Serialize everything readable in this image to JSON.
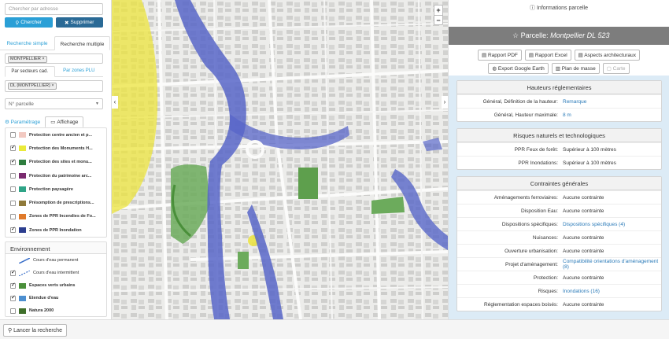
{
  "left": {
    "search_placeholder": "Chercher par adresse",
    "btn_search": "Chercher",
    "btn_delete": "Supprimer",
    "tab_simple": "Recherche simple",
    "tab_multiple": "Recherche multiple",
    "tag_city": "MONTPELLIER",
    "tab_sections": "Par secteurs cad.",
    "tab_zones": "Par zones PLU",
    "tag_section": "DL (MONTPELLIER)",
    "select_parcel": "N° parcelle",
    "param_label": "Paramétrage",
    "affichage_label": "Affichage",
    "layers": [
      {
        "label": "Protection centre ancien et p...",
        "color": "#f2c9c1",
        "checked": false
      },
      {
        "label": "Protection des Monuments H...",
        "color": "#eaea3a",
        "checked": true
      },
      {
        "label": "Protection des sites et monu...",
        "color": "#2e7d3e",
        "checked": true
      },
      {
        "label": "Protection du patrimoine arc...",
        "color": "#7a2a6e",
        "checked": false
      },
      {
        "label": "Protection paysagère",
        "color": "#2fa487",
        "checked": false
      },
      {
        "label": "Présomption de prescriptions...",
        "color": "#8f7a3a",
        "checked": false
      },
      {
        "label": "Zones de PPR Incendies de Fo...",
        "color": "#e07a2a",
        "checked": false
      },
      {
        "label": "Zones de PPR Inondation",
        "color": "#2c3e8f",
        "checked": true
      }
    ],
    "env_title": "Environnement",
    "env_items": [
      {
        "label": "Cours d'eau permanent",
        "kind": "line-solid",
        "checked": false
      },
      {
        "label": "Cours d'eau intermittent",
        "kind": "line-dash",
        "checked": true
      },
      {
        "label": "Espaces verts urbains",
        "color": "#4a8f3a",
        "checked": true
      },
      {
        "label": "Etendue d'eau",
        "color": "#4d8fd0",
        "checked": true
      },
      {
        "label": "Natura 2000",
        "color": "#3f6f2a",
        "checked": false
      }
    ]
  },
  "map": {
    "zoom_in": "+",
    "zoom_out": "−",
    "collapse_left": "‹",
    "collapse_right": "›"
  },
  "right": {
    "info_header": "Informations parcelle",
    "parcel_prefix": "Parcelle:",
    "parcel_name": "Montpellier DL 523",
    "actions": [
      "Rapport PDF",
      "Rapport Excel",
      "Aspects architecturaux",
      "Export Google Earth",
      "Plan de masse",
      "Carte"
    ],
    "sections": [
      {
        "title": "Hauteurs réglementaires",
        "rows": [
          {
            "k": "Général, Définition de la hauteur:",
            "v": "Remarque",
            "link": true
          },
          {
            "k": "Général, Hauteur maximale:",
            "v": "8 m",
            "link": true
          }
        ]
      },
      {
        "title": "Risques naturels et technologiques",
        "rows": [
          {
            "k": "PPR Feux de forêt:",
            "v": "Supérieur à 100 mètres",
            "link": false
          },
          {
            "k": "PPR Inondations:",
            "v": "Supérieur à 100 mètres",
            "link": false
          }
        ]
      },
      {
        "title": "Contraintes générales",
        "rows": [
          {
            "k": "Aménagements ferroviaires:",
            "v": "Aucune contrainte",
            "link": false
          },
          {
            "k": "Disposition Eau:",
            "v": "Aucune contrainte",
            "link": false
          },
          {
            "k": "Dispositions spécifiques:",
            "v": "Dispositions spécifiques (4)",
            "link": true
          },
          {
            "k": "Nuisances:",
            "v": "Aucune contrainte",
            "link": false
          },
          {
            "k": "Ouverture urbanisation:",
            "v": "Aucune contrainte",
            "link": false
          },
          {
            "k": "Projet d'aménagement:",
            "v": "Compatibilité orientations d'aménagement (8)",
            "link": true
          },
          {
            "k": "Protection:",
            "v": "Aucune contrainte",
            "link": false
          },
          {
            "k": "Risques:",
            "v": "Inondations (16)",
            "link": true
          },
          {
            "k": "Réglementation espaces boisés:",
            "v": "Aucune contrainte",
            "link": false
          }
        ]
      }
    ]
  },
  "bottom": {
    "launch_label": "Lancer la recherche"
  }
}
